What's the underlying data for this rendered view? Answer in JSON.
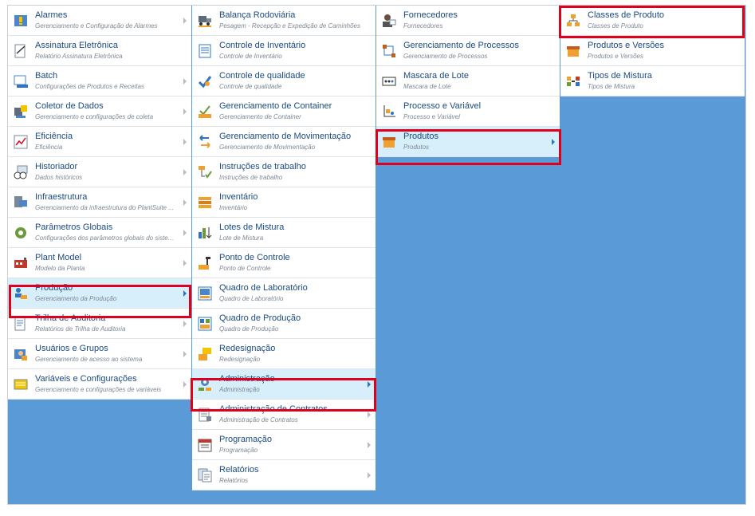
{
  "columns": [
    {
      "name": "col1",
      "items": [
        {
          "title": "Alarmes",
          "sub": "Gerenciamento e Configuração de Alarmes",
          "icon": "alarm-icon",
          "chevron": true
        },
        {
          "title": "Assinatura Eletrônica",
          "sub": "Relatório Assinatura Eletrônica",
          "icon": "signature-icon",
          "chevron": false
        },
        {
          "title": "Batch",
          "sub": "Configurações de Produtos e Receitas",
          "icon": "batch-icon",
          "chevron": true
        },
        {
          "title": "Coletor de Dados",
          "sub": "Gerenciamento e configurações de coleta",
          "icon": "data-collector-icon",
          "chevron": true
        },
        {
          "title": "Eficiência",
          "sub": "Eficiência",
          "icon": "efficiency-chart-icon",
          "chevron": true
        },
        {
          "title": "Historiador",
          "sub": "Dados históricos",
          "icon": "historian-icon",
          "chevron": true
        },
        {
          "title": "Infraestrutura",
          "sub": "Gerenciamento da infraestrutura do PlantSuite ...",
          "icon": "infrastructure-icon",
          "chevron": true
        },
        {
          "title": "Parâmetros Globais",
          "sub": "Configurações dos parâmetros globais do siste...",
          "icon": "gear-icon",
          "chevron": true
        },
        {
          "title": "Plant Model",
          "sub": "Modelo da Planta",
          "icon": "plant-model-icon",
          "chevron": true
        },
        {
          "title": "Produção",
          "sub": "Gerenciamento da Produção",
          "icon": "production-icon",
          "chevron": true,
          "selected": true
        },
        {
          "title": "Trilha de Auditoria",
          "sub": "Relatórios de Trilha de Auditoria",
          "icon": "audit-trail-icon",
          "chevron": true
        },
        {
          "title": "Usuários e Grupos",
          "sub": "Gerenciamento de acesso ao sistema",
          "icon": "users-groups-icon",
          "chevron": true
        },
        {
          "title": "Variáveis e Configurações",
          "sub": "Gerenciamento e configurações de variáveis",
          "icon": "variables-icon",
          "chevron": true
        }
      ]
    },
    {
      "name": "col2",
      "items": [
        {
          "title": "Balança Rodoviária",
          "sub": "Pesagem - Recepção e Expedição de Caminhões",
          "icon": "truck-scale-icon",
          "chevron": false
        },
        {
          "title": "Controle de Inventário",
          "sub": "Controle de Inventário",
          "icon": "inventory-control-icon",
          "chevron": false
        },
        {
          "title": "Controle de qualidade",
          "sub": "Controle de qualidade",
          "icon": "quality-control-icon",
          "chevron": false
        },
        {
          "title": "Gerenciamento de Container",
          "sub": "Gerenciamento de Container",
          "icon": "container-icon",
          "chevron": false
        },
        {
          "title": "Gerenciamento de Movimentação",
          "sub": "Gerenciamento de Movimentação",
          "icon": "movement-arrows-icon",
          "chevron": false
        },
        {
          "title": "Instruções de trabalho",
          "sub": "Instruções de trabalho",
          "icon": "work-instructions-icon",
          "chevron": false
        },
        {
          "title": "Inventário",
          "sub": "Inventário",
          "icon": "inventory-stack-icon",
          "chevron": false
        },
        {
          "title": "Lotes de Mistura",
          "sub": "Lote de Mistura",
          "icon": "mix-lots-icon",
          "chevron": false
        },
        {
          "title": "Ponto de Controle",
          "sub": "Ponto de Controle",
          "icon": "control-point-icon",
          "chevron": false
        },
        {
          "title": "Quadro de Laboratório",
          "sub": "Quadro de Laboratório",
          "icon": "lab-board-icon",
          "chevron": false
        },
        {
          "title": "Quadro de Produção",
          "sub": "Quadro de Produção",
          "icon": "production-board-icon",
          "chevron": false
        },
        {
          "title": "Redesignação",
          "sub": "Redesignação",
          "icon": "reassign-icon",
          "chevron": false
        },
        {
          "title": "Administração",
          "sub": "Administração",
          "icon": "admin-gear-icon",
          "chevron": true,
          "selected": true
        },
        {
          "title": "Administração de Contratos",
          "sub": "Administração de Contratos",
          "icon": "contracts-icon",
          "chevron": true
        },
        {
          "title": "Programação",
          "sub": "Programação",
          "icon": "schedule-icon",
          "chevron": true
        },
        {
          "title": "Relatórios",
          "sub": "Relatórios",
          "icon": "reports-icon",
          "chevron": true
        }
      ]
    },
    {
      "name": "col3",
      "items": [
        {
          "title": "Fornecedores",
          "sub": "Fornecedores",
          "icon": "supplier-icon",
          "chevron": false
        },
        {
          "title": "Gerenciamento de Processos",
          "sub": "Gerenciamento de Processos",
          "icon": "process-flow-icon",
          "chevron": false
        },
        {
          "title": "Mascara de Lote",
          "sub": "Mascara de Lote",
          "icon": "lot-mask-icon",
          "chevron": false
        },
        {
          "title": "Processo e Variável",
          "sub": "Processo e Variável",
          "icon": "process-variable-icon",
          "chevron": false
        },
        {
          "title": "Produtos",
          "sub": "Produtos",
          "icon": "products-box-icon",
          "chevron": true,
          "selected": true
        }
      ]
    },
    {
      "name": "col4",
      "items": [
        {
          "title": "Classes de Produto",
          "sub": "Classes de Produto",
          "icon": "product-classes-icon",
          "chevron": false
        },
        {
          "title": "Produtos e Versões",
          "sub": "Produtos e Versões",
          "icon": "product-versions-icon",
          "chevron": false
        },
        {
          "title": "Tipos de Mistura",
          "sub": "Tipos de Mistura",
          "icon": "mix-types-icon",
          "chevron": false
        }
      ]
    }
  ],
  "colors": {
    "background": "#5a9ad6",
    "title": "#1b4a82",
    "subtitle": "#7d8894",
    "selected": "#d7eefb",
    "highlight": "#e0001b"
  }
}
